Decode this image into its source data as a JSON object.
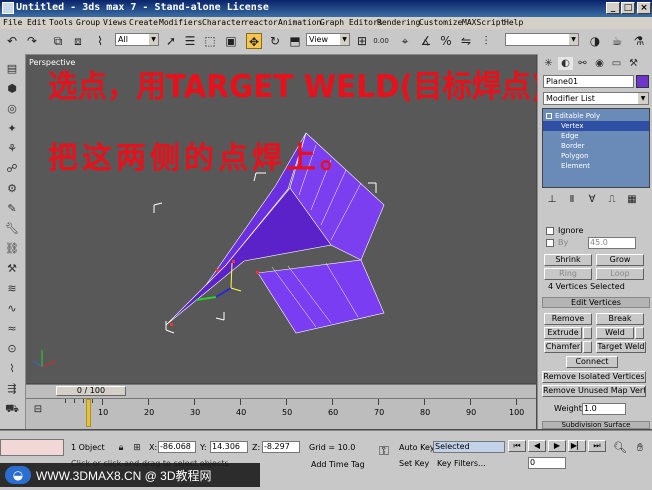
{
  "window": {
    "title": "Untitled - 3ds max 7  - Stand-alone License",
    "buttons": {
      "min": "_",
      "max": "□",
      "close": "×"
    }
  },
  "menu": [
    "File",
    "Edit",
    "Tools",
    "Group",
    "Views",
    "Create",
    "Modifiers",
    "Character",
    "reactor",
    "Animation",
    "Graph Editors",
    "Rendering",
    "Customize",
    "MAXScript",
    "Help"
  ],
  "toolbar": {
    "selection_filter": "All",
    "coord_system": "View",
    "spinner_value": "0.00"
  },
  "viewport": {
    "label": "Perspective",
    "annotation_line1": "选点，用TARGET WELD(目标焊点)",
    "annotation_line2": "把这两侧的点焊上。"
  },
  "command_panel": {
    "object_name": "Plane01",
    "modifier_list": "Modifier List",
    "stack": [
      "Editable Poly",
      "Vertex",
      "Edge",
      "Border",
      "Polygon",
      "Element"
    ],
    "ignore_label": "Ignore",
    "by_label": "By",
    "by_value": "45.0",
    "shrink": "Shrink",
    "grow": "Grow",
    "ring": "Ring",
    "loop": "Loop",
    "selection_status": "4 Vertices Selected",
    "rollout_edit_vertices": "Edit Vertices",
    "remove": "Remove",
    "break": "Break",
    "extrude": "Extrude",
    "weld": "Weld",
    "chamfer": "Chamfer",
    "target_weld": "Target Weld",
    "connect": "Connect",
    "remove_isolated": "Remove Isolated Vertices",
    "remove_unused_map": "Remove Unused Map Verts",
    "weight_label": "Weight:",
    "weight_value": "1.0",
    "rollout_subdivision": "Subdivision Surface"
  },
  "timeline": {
    "slider": "0 / 100",
    "ticks": [
      "10",
      "20",
      "30",
      "40",
      "50",
      "60",
      "70",
      "80",
      "90",
      "100"
    ]
  },
  "status": {
    "selection": "1 Object",
    "x_label": "X:",
    "x": "-86.068",
    "y_label": "Y:",
    "y": "14.306",
    "z_label": "Z:",
    "z": "-8.297",
    "grid": "Grid = 10.0",
    "autokey": "Auto Key",
    "selected": "Selected",
    "prompt": "Click or click-and-drag to select objects",
    "add_time_tag": "Add Time Tag",
    "set_key": "Set Key",
    "key_filters": "Key Filters...",
    "frame": "0"
  },
  "watermark": "WWW.3DMAX8.CN @ 3D教程网"
}
